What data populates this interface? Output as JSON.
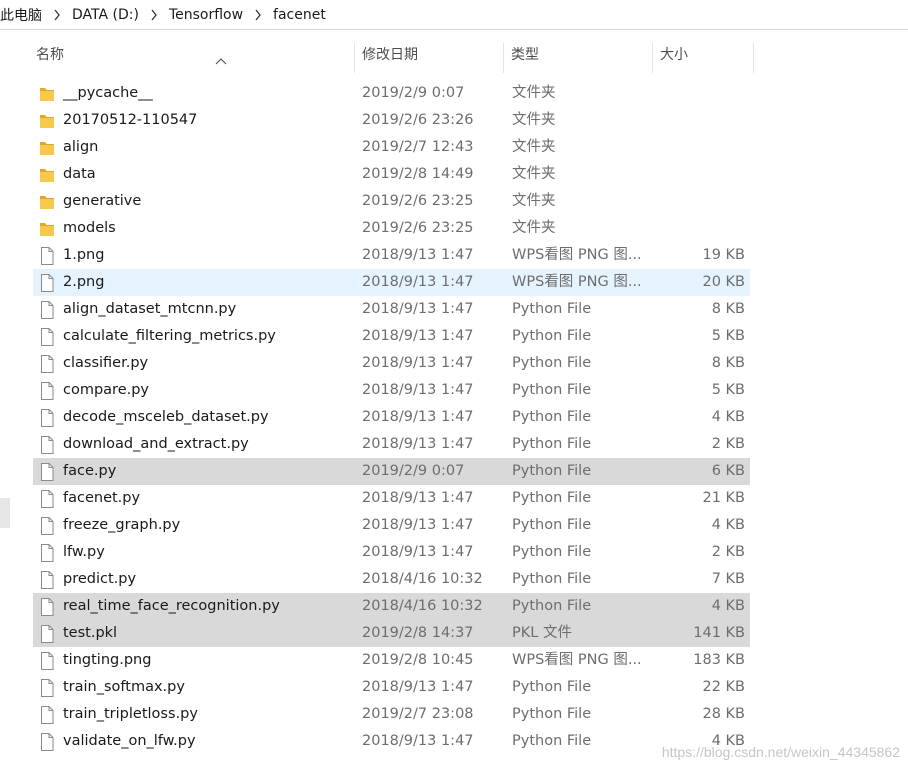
{
  "breadcrumb": [
    {
      "label": "此电脑"
    },
    {
      "label": "DATA (D:)"
    },
    {
      "label": "Tensorflow"
    },
    {
      "label": "facenet"
    }
  ],
  "columns": {
    "name": "名称",
    "date": "修改日期",
    "type": "类型",
    "size": "大小"
  },
  "files": [
    {
      "name": "__pycache__",
      "date": "2019/2/9 0:07",
      "type": "文件夹",
      "size": "",
      "kind": "folder",
      "state": "normal"
    },
    {
      "name": "20170512-110547",
      "date": "2019/2/6 23:26",
      "type": "文件夹",
      "size": "",
      "kind": "folder",
      "state": "normal"
    },
    {
      "name": "align",
      "date": "2019/2/7 12:43",
      "type": "文件夹",
      "size": "",
      "kind": "folder",
      "state": "normal"
    },
    {
      "name": "data",
      "date": "2019/2/8 14:49",
      "type": "文件夹",
      "size": "",
      "kind": "folder",
      "state": "normal"
    },
    {
      "name": "generative",
      "date": "2019/2/6 23:25",
      "type": "文件夹",
      "size": "",
      "kind": "folder",
      "state": "normal"
    },
    {
      "name": "models",
      "date": "2019/2/6 23:25",
      "type": "文件夹",
      "size": "",
      "kind": "folder",
      "state": "normal"
    },
    {
      "name": "1.png",
      "date": "2018/9/13 1:47",
      "type": "WPS看图 PNG 图...",
      "size": "19 KB",
      "kind": "file",
      "state": "normal"
    },
    {
      "name": "2.png",
      "date": "2018/9/13 1:47",
      "type": "WPS看图 PNG 图...",
      "size": "20 KB",
      "kind": "file",
      "state": "hover"
    },
    {
      "name": "align_dataset_mtcnn.py",
      "date": "2018/9/13 1:47",
      "type": "Python File",
      "size": "8 KB",
      "kind": "file",
      "state": "normal"
    },
    {
      "name": "calculate_filtering_metrics.py",
      "date": "2018/9/13 1:47",
      "type": "Python File",
      "size": "5 KB",
      "kind": "file",
      "state": "normal"
    },
    {
      "name": "classifier.py",
      "date": "2018/9/13 1:47",
      "type": "Python File",
      "size": "8 KB",
      "kind": "file",
      "state": "normal"
    },
    {
      "name": "compare.py",
      "date": "2018/9/13 1:47",
      "type": "Python File",
      "size": "5 KB",
      "kind": "file",
      "state": "normal"
    },
    {
      "name": "decode_msceleb_dataset.py",
      "date": "2018/9/13 1:47",
      "type": "Python File",
      "size": "4 KB",
      "kind": "file",
      "state": "normal"
    },
    {
      "name": "download_and_extract.py",
      "date": "2018/9/13 1:47",
      "type": "Python File",
      "size": "2 KB",
      "kind": "file",
      "state": "normal"
    },
    {
      "name": "face.py",
      "date": "2019/2/9 0:07",
      "type": "Python File",
      "size": "6 KB",
      "kind": "file",
      "state": "selected"
    },
    {
      "name": "facenet.py",
      "date": "2018/9/13 1:47",
      "type": "Python File",
      "size": "21 KB",
      "kind": "file",
      "state": "normal"
    },
    {
      "name": "freeze_graph.py",
      "date": "2018/9/13 1:47",
      "type": "Python File",
      "size": "4 KB",
      "kind": "file",
      "state": "normal"
    },
    {
      "name": "lfw.py",
      "date": "2018/9/13 1:47",
      "type": "Python File",
      "size": "2 KB",
      "kind": "file",
      "state": "normal"
    },
    {
      "name": "predict.py",
      "date": "2018/4/16 10:32",
      "type": "Python File",
      "size": "7 KB",
      "kind": "file",
      "state": "normal"
    },
    {
      "name": "real_time_face_recognition.py",
      "date": "2018/4/16 10:32",
      "type": "Python File",
      "size": "4 KB",
      "kind": "file",
      "state": "selected"
    },
    {
      "name": "test.pkl",
      "date": "2019/2/8 14:37",
      "type": "PKL 文件",
      "size": "141 KB",
      "kind": "file",
      "state": "selected"
    },
    {
      "name": "tingting.png",
      "date": "2019/2/8 10:45",
      "type": "WPS看图 PNG 图...",
      "size": "183 KB",
      "kind": "file",
      "state": "normal"
    },
    {
      "name": "train_softmax.py",
      "date": "2018/9/13 1:47",
      "type": "Python File",
      "size": "22 KB",
      "kind": "file",
      "state": "normal"
    },
    {
      "name": "train_tripletloss.py",
      "date": "2019/2/7 23:08",
      "type": "Python File",
      "size": "28 KB",
      "kind": "file",
      "state": "normal"
    },
    {
      "name": "validate_on_lfw.py",
      "date": "2018/9/13 1:47",
      "type": "Python File",
      "size": "4 KB",
      "kind": "file",
      "state": "normal"
    }
  ],
  "watermark": "https://blog.csdn.net/weixin_44345862",
  "colors": {
    "folder": "#f8c84a",
    "folder_dark": "#e0a52a",
    "hover": "#e5f3ff",
    "selected": "#d9d9d9"
  },
  "icons": {
    "folder": "folder-icon",
    "file": "file-icon",
    "separator": "chevron-right-icon",
    "sort": "sort-up-icon"
  }
}
